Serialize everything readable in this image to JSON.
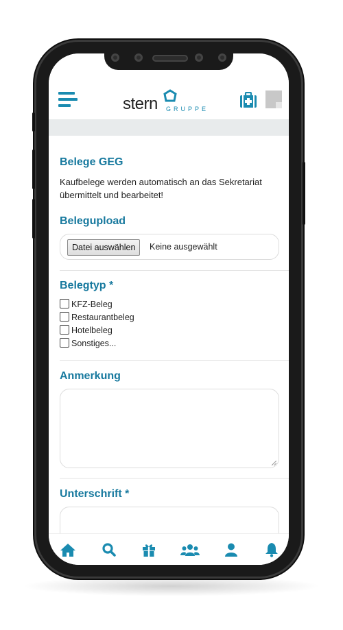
{
  "header": {
    "logo_text": "stern",
    "logo_sub": "GRUPPE",
    "menu_icon": "hamburger-menu-icon",
    "medkit_icon": "medical-kit-icon",
    "note_icon": "note-icon"
  },
  "form": {
    "title": "Belege GEG",
    "intro": "Kaufbelege werden automatisch an das Sekretariat übermittelt und bearbeitet!",
    "upload": {
      "label": "Belegupload",
      "button": "Datei auswählen",
      "status": "Keine ausgewählt"
    },
    "type": {
      "label": "Belegtyp *",
      "options": [
        "KFZ-Beleg",
        "Restaurantbeleg",
        "Hotelbeleg",
        "Sonstiges..."
      ]
    },
    "remark": {
      "label": "Anmerkung",
      "value": ""
    },
    "signature": {
      "label": "Unterschrift *"
    }
  },
  "bottom_nav": {
    "items": [
      "home-icon",
      "search-icon",
      "gift-icon",
      "users-icon",
      "user-icon",
      "bell-icon"
    ]
  },
  "colors": {
    "accent": "#17799e",
    "icon_blue": "#1a8bb0",
    "band": "#e8ebec"
  }
}
